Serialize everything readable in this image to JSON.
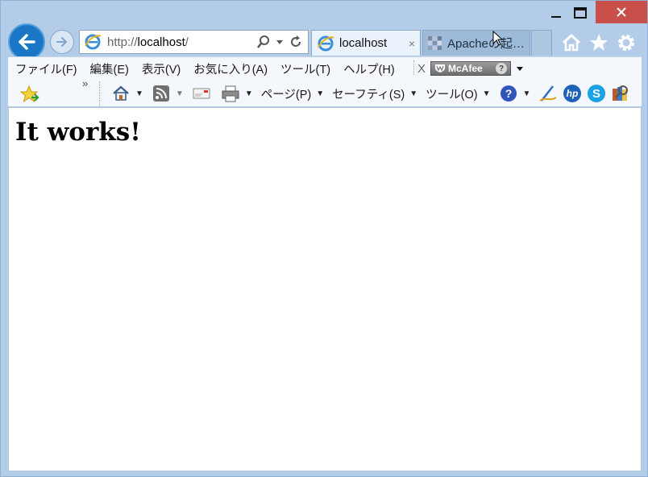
{
  "window": {
    "caption": {
      "minimize_icon": "minimize-icon",
      "maximize_icon": "maximize-icon",
      "close_icon": "close-icon"
    },
    "close_color": "#c94f4a"
  },
  "navigation": {
    "address": {
      "scheme": "http://",
      "host": "localhost",
      "path": "/"
    }
  },
  "tabs": [
    {
      "label": "localhost",
      "close": "×",
      "active": true
    },
    {
      "label": "Apacheの起…",
      "active": false
    }
  ],
  "menubar": {
    "items": [
      "ファイル(F)",
      "編集(E)",
      "表示(V)",
      "お気に入り(A)",
      "ツール(T)",
      "ヘルプ(H)"
    ]
  },
  "mcafee": {
    "close": "X",
    "label": "McAfee",
    "help": "?"
  },
  "commandbar": {
    "chevron": "»",
    "items": [
      {
        "label": "ページ(P)"
      },
      {
        "label": "セーフティ(S)"
      },
      {
        "label": "ツール(O)"
      }
    ]
  },
  "content": {
    "heading": "It works!"
  },
  "colors": {
    "accent": "#1a77c5",
    "frame": "#b3cde8"
  }
}
